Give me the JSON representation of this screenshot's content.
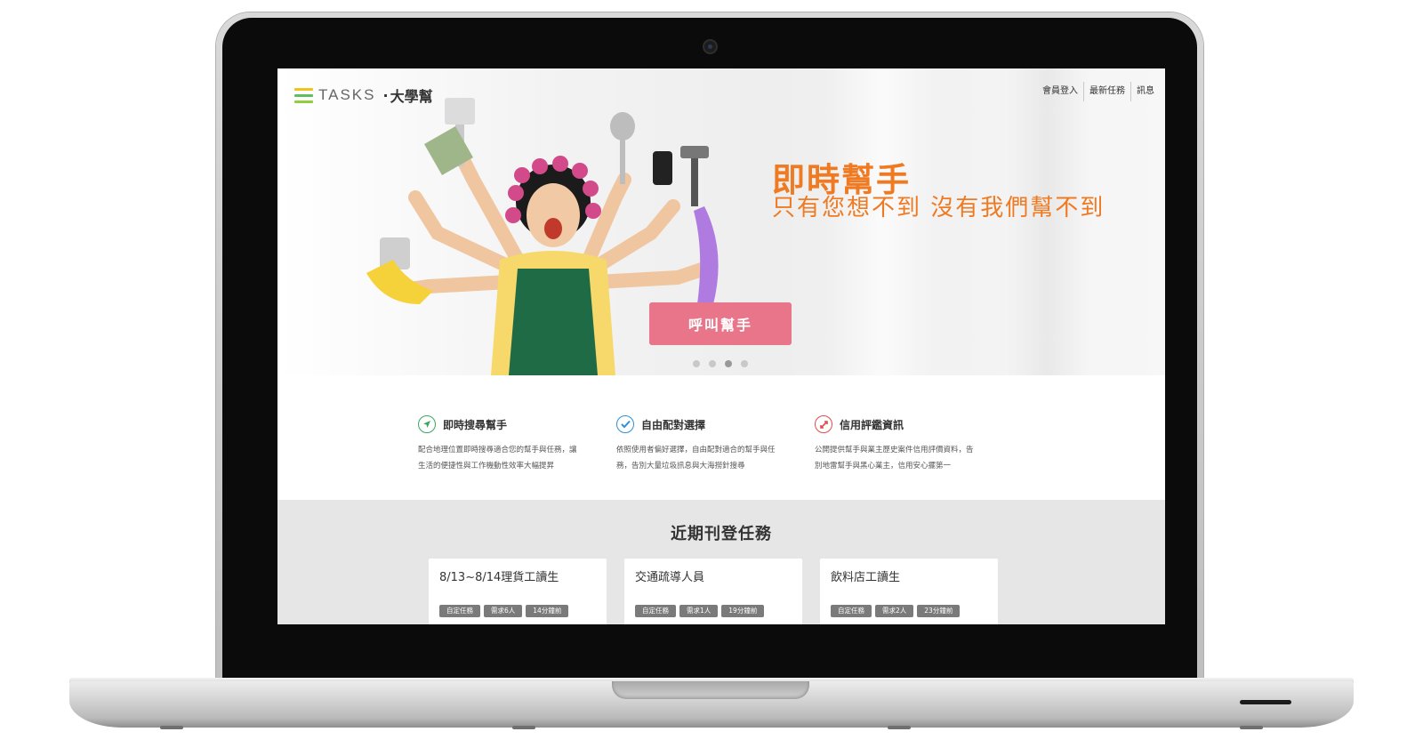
{
  "brand": {
    "name": "TASKS",
    "separator": "·",
    "subname": "大學幫"
  },
  "nav": {
    "items": [
      {
        "label": "會員登入"
      },
      {
        "label": "最新任務"
      },
      {
        "label": "訊息"
      }
    ]
  },
  "hero": {
    "title": "即時幫手",
    "subtitle": "只有您想不到 沒有我們幫不到",
    "cta_label": "呼叫幫手",
    "slides_total": 4,
    "active_slide": 3,
    "accent_color": "#ef7a22",
    "cta_color": "#e8758a"
  },
  "features": [
    {
      "icon": "navigation-arrow-icon",
      "icon_color": "#3aa55c",
      "title": "即時搜尋幫手",
      "desc_line1": "配合地理位置即時搜尋適合您的幫手與任務，讓",
      "desc_line2": "生活的便捷性與工作機動性效率大幅提昇"
    },
    {
      "icon": "checkmark-icon",
      "icon_color": "#2f8fd8",
      "title": "自由配對選擇",
      "desc_line1": "依照使用者偏好選擇，自由配對適合的幫手與任",
      "desc_line2": "務，告別大量垃圾訊息與大海撈針搜尋"
    },
    {
      "icon": "handshake-icon",
      "icon_color": "#e24b4b",
      "title": "信用評鑑資訊",
      "desc_line1": "公開提供幫手與業主歷史案件信用評價資料，告",
      "desc_line2": "別地雷幫手與黑心業主，信用安心擺第一"
    }
  ],
  "recent": {
    "title": "近期刊登任務",
    "cards": [
      {
        "title": "8/13~8/14理貨工讀生",
        "tags": [
          "自定任務",
          "需求6人",
          "14分鐘前"
        ]
      },
      {
        "title": "交通疏導人員",
        "tags": [
          "自定任務",
          "需求1人",
          "19分鐘前"
        ]
      },
      {
        "title": "飲料店工讀生",
        "tags": [
          "自定任務",
          "需求2人",
          "23分鐘前"
        ]
      }
    ]
  }
}
